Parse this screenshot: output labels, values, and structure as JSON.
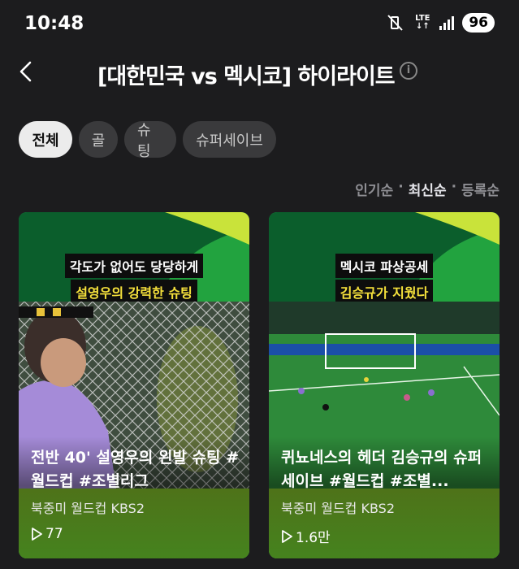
{
  "status": {
    "time": "10:48",
    "network": "LTE",
    "battery": "96"
  },
  "header": {
    "title": "[대한민국 vs 멕시코] 하이라이트",
    "info": "i"
  },
  "filters": [
    {
      "label": "전체",
      "active": true
    },
    {
      "label": "골",
      "active": false
    },
    {
      "label": "슈팅",
      "active": false
    },
    {
      "label": "슈퍼세이브",
      "active": false
    }
  ],
  "sort": {
    "popular": "인기순",
    "latest": "최신순",
    "registered": "등록순",
    "separator": "·"
  },
  "cards": [
    {
      "caption_line1": "각도가 없어도 당당하게",
      "caption_line2": "설영우의 강력한 슈팅",
      "title": "전반 40' 설영우의 왼발 슈팅 #월드컵 #조별리그",
      "channel": "북중미 월드컵 KBS2",
      "views": "77"
    },
    {
      "caption_line1": "멕시코 파상공세",
      "caption_line2": "김승규가 지웠다",
      "title": "퀴뇨네스의 헤더 김승규의 슈퍼 세이브 #월드컵 #조별...",
      "channel": "북중미 월드컵 KBS2",
      "views": "1.6만"
    }
  ]
}
